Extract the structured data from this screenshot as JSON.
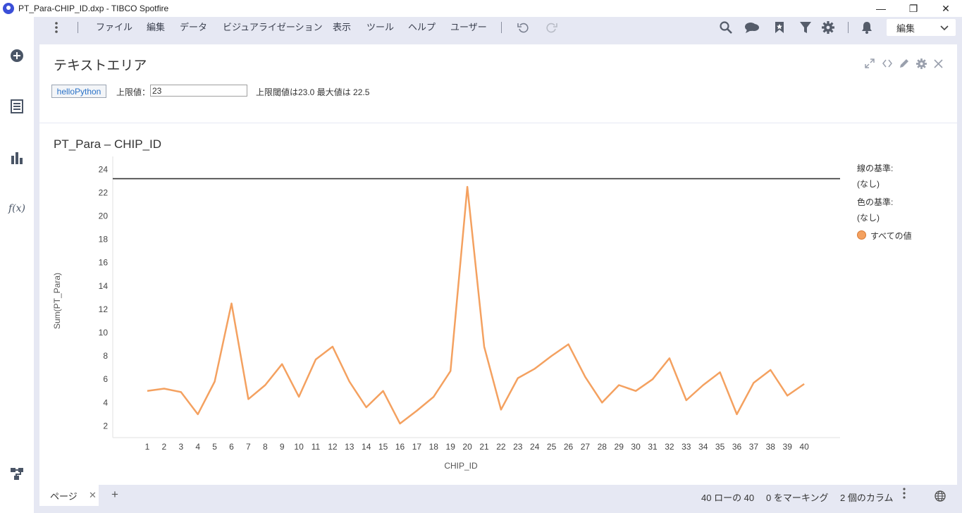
{
  "window": {
    "title": "PT_Para-CHIP_ID.dxp - TIBCO Spotfire",
    "min_label": "—",
    "max_label": "❐",
    "close_label": "✕"
  },
  "sidebar": {
    "icons": [
      "add-icon",
      "list-icon",
      "bar-chart-icon",
      "fx-icon",
      "flow-icon"
    ],
    "fx_label": "f(x)"
  },
  "menu": {
    "items": [
      "ファイル",
      "編集",
      "データ",
      "ビジュアライゼーション",
      "表示",
      "ツール",
      "ヘルプ",
      "ユーザー"
    ],
    "mode": "編集"
  },
  "text_area": {
    "title": "テキストエリア",
    "button_label": "helloPython",
    "limit_label": "上限値：",
    "limit_value": "23",
    "limit_text": "上限閾値は23.0 最大値は 22.5"
  },
  "legend": {
    "line_by_label": "線の基準:",
    "line_by_value": "(なし)",
    "color_by_label": "色の基準:",
    "color_by_value": "(なし)",
    "item_label": "すべての値"
  },
  "chart_data": {
    "type": "line",
    "title": "PT_Para – CHIP_ID",
    "xlabel": "CHIP_ID",
    "ylabel": "Sum(PT_Para)",
    "x": [
      1,
      2,
      3,
      4,
      5,
      6,
      7,
      8,
      9,
      10,
      11,
      12,
      13,
      14,
      15,
      16,
      17,
      18,
      19,
      20,
      21,
      22,
      23,
      24,
      25,
      26,
      27,
      28,
      29,
      30,
      31,
      32,
      33,
      34,
      35,
      36,
      37,
      38,
      39,
      40
    ],
    "series": [
      {
        "values": [
          5.0,
          5.2,
          4.9,
          3.0,
          5.8,
          12.5,
          4.3,
          5.5,
          7.3,
          4.5,
          7.7,
          8.8,
          5.8,
          3.6,
          5.0,
          2.2,
          3.3,
          4.5,
          6.7,
          22.5,
          8.8,
          3.4,
          6.1,
          6.9,
          8.0,
          9.0,
          6.2,
          4.0,
          5.5,
          5.0,
          6.0,
          7.8,
          4.2,
          5.5,
          6.6,
          3.0,
          5.7,
          6.8,
          4.6,
          5.6
        ],
        "color": "#f4a160"
      }
    ],
    "reference_line": {
      "y": 23.2,
      "color": "#333333"
    },
    "yticks": [
      2,
      4,
      6,
      8,
      10,
      12,
      14,
      16,
      18,
      20,
      22,
      24
    ],
    "ylim": [
      1,
      24.5
    ],
    "grid": false
  },
  "status": {
    "page_tab": "ページ",
    "rows": "40 ローの 40",
    "marked": "0 をマーキング",
    "columns": "2 個のカラム"
  }
}
